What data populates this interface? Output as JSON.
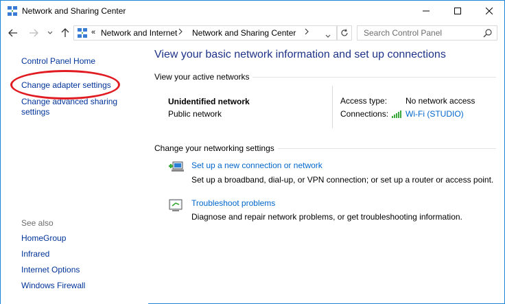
{
  "window": {
    "title": "Network and Sharing Center",
    "minimize_icon": "minimize-icon",
    "maximize_icon": "maximize-icon",
    "close_icon": "close-icon"
  },
  "address_bar": {
    "overflow": "«",
    "crumbs": [
      "Network and Internet",
      "Network and Sharing Center"
    ],
    "search_placeholder": "Search Control Panel"
  },
  "left_pane": {
    "links": [
      "Control Panel Home",
      "Change adapter settings",
      "Change advanced sharing settings"
    ],
    "see_also_label": "See also",
    "see_also": [
      "HomeGroup",
      "Infrared",
      "Internet Options",
      "Windows Firewall"
    ],
    "highlight_color": "#e11b22"
  },
  "main": {
    "title": "View your basic network information and set up connections",
    "active_networks_label": "View your active networks",
    "network": {
      "name": "Unidentified network",
      "type": "Public network",
      "access_type_label": "Access type:",
      "access_type_value": "No network access",
      "connections_label": "Connections:",
      "connection_value": "Wi-Fi (STUDIO)"
    },
    "change_settings_label": "Change your networking settings",
    "tasks": [
      {
        "link": "Set up a new connection or network",
        "description": "Set up a broadband, dial-up, or VPN connection; or set up a router or access point."
      },
      {
        "link": "Troubleshoot problems",
        "description": "Diagnose and repair network problems, or get troubleshooting information."
      }
    ]
  },
  "colors": {
    "window_border": "#1883d7",
    "link": "#0066cc",
    "nav_link": "#003399",
    "title": "#1e3287"
  }
}
